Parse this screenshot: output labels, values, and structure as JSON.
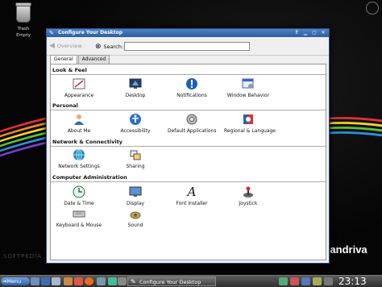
{
  "desktop": {
    "trash_label": "Trash\nEmpty",
    "watermark": "SOFTPEDIA",
    "brand": "Mandriva"
  },
  "window": {
    "title": "Configure Your Desktop",
    "toolbar": {
      "overview_label": "Overview",
      "search_label": "Search:",
      "search_value": ""
    },
    "tabs": [
      {
        "label": "General",
        "active": true
      },
      {
        "label": "Advanced",
        "active": false
      }
    ],
    "sections": [
      {
        "title": "Look & Feel",
        "items": [
          {
            "label": "Appearance",
            "icon": "appearance-icon"
          },
          {
            "label": "Desktop",
            "icon": "desktop-icon"
          },
          {
            "label": "Notifications",
            "icon": "notifications-icon"
          },
          {
            "label": "Window Behavior",
            "icon": "window-behavior-icon"
          }
        ]
      },
      {
        "title": "Personal",
        "items": [
          {
            "label": "About Me",
            "icon": "about-me-icon"
          },
          {
            "label": "Accessibility",
            "icon": "accessibility-icon"
          },
          {
            "label": "Default Applications",
            "icon": "default-applications-icon"
          },
          {
            "label": "Regional & Language",
            "icon": "regional-language-icon"
          }
        ]
      },
      {
        "title": "Network & Connectivity",
        "items": [
          {
            "label": "Network Settings",
            "icon": "network-settings-icon"
          },
          {
            "label": "Sharing",
            "icon": "sharing-icon"
          }
        ]
      },
      {
        "title": "Computer Administration",
        "items": [
          {
            "label": "Date & Time",
            "icon": "date-time-icon"
          },
          {
            "label": "Display",
            "icon": "display-icon"
          },
          {
            "label": "Font Installer",
            "icon": "font-installer-icon"
          },
          {
            "label": "Joystick",
            "icon": "joystick-icon"
          },
          {
            "label": "Keyboard & Mouse",
            "icon": "keyboard-mouse-icon"
          },
          {
            "label": "Sound",
            "icon": "sound-icon"
          }
        ]
      }
    ]
  },
  "taskbar": {
    "menu_label": "Menu",
    "task_label": "Configure Your Desktop",
    "clock": "23:13"
  },
  "colors": {
    "titlebar": "#2d5e9f",
    "menu_button": "#2f63b0",
    "taskbar": "#3a3a3a"
  }
}
